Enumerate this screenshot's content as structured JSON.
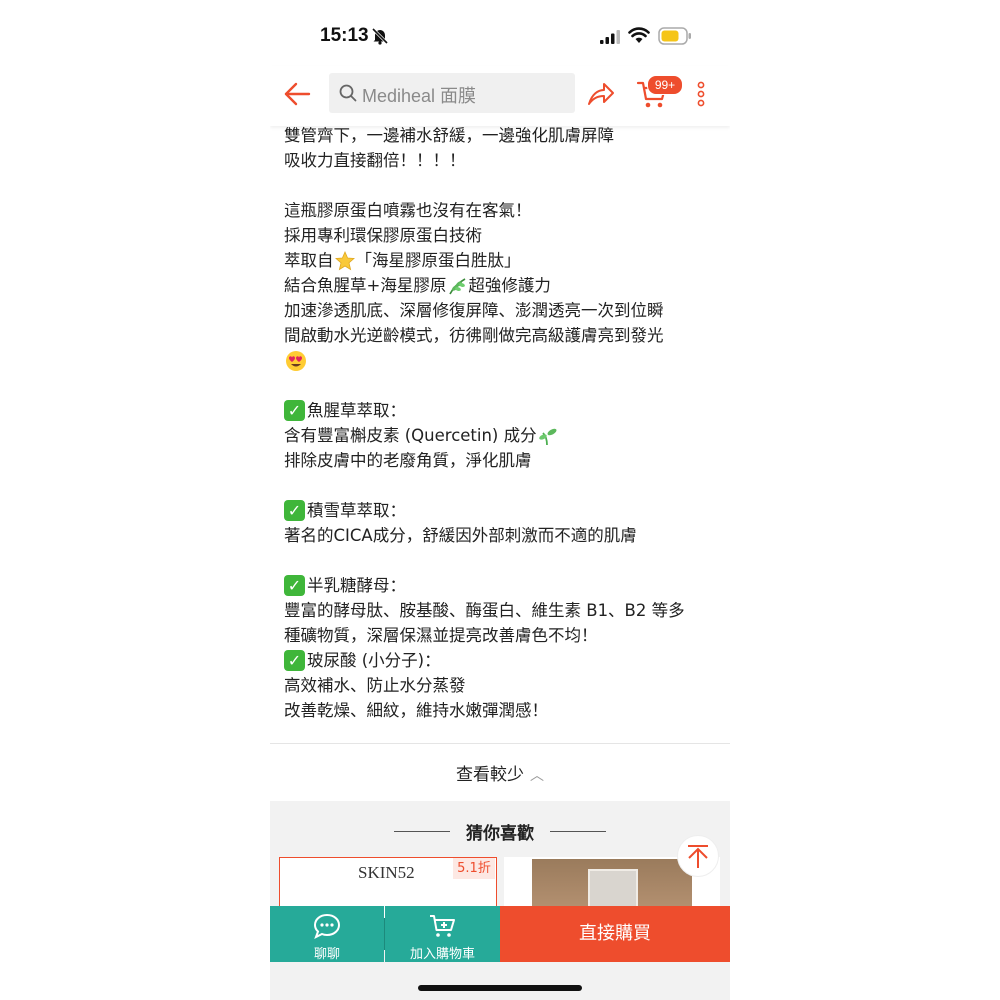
{
  "status_bar": {
    "time": "15:13"
  },
  "header": {
    "search_placeholder": "Mediheal 面膜",
    "cart_badge": "99+"
  },
  "description": {
    "lines": [
      "雙管齊下，一邊補水舒緩，一邊強化肌膚屏障",
      "吸收力直接翻倍！！！！",
      "",
      "這瓶膠原蛋白噴霧也沒有在客氣！",
      "採用專利環保膠原蛋白技術",
      "萃取自{star}「海星膠原蛋白胜肽」",
      "結合魚腥草+海星膠原{herb}超強修護力",
      "加速滲透肌底、深層修復屏障、澎潤透亮一次到位瞬",
      "間啟動水光逆齡模式，彷彿剛做完高級護膚亮到發光",
      "{hearteyes}",
      "",
      "{check}魚腥草萃取：",
      "含有豐富槲皮素 (Quercetin) 成分{seedling}",
      "排除皮膚中的老廢角質，淨化肌膚",
      "",
      "{check}積雪草萃取：",
      "著名的CICA成分，舒緩因外部刺激而不適的肌膚",
      "",
      "{check}半乳糖酵母：",
      "豐富的酵母肽、胺基酸、酶蛋白、維生素 B1、B2 等多",
      "種礦物質，深層保濕並提亮改善膚色不均！",
      "{check}玻尿酸 (小分子)：",
      "高效補水、防止水分蒸發",
      "改善乾燥、細紋，維持水嫩彈潤感！"
    ]
  },
  "see_less": {
    "label": "查看較少"
  },
  "recommend": {
    "title": "猜你喜歡",
    "products": [
      {
        "brand": "SKIN52",
        "discount": "5.1折"
      },
      {
        "brand": "",
        "discount": ""
      }
    ]
  },
  "bottom_bar": {
    "chat_label": "聊聊",
    "add_cart_label": "加入購物車",
    "buy_label": "直接購買"
  },
  "colors": {
    "accent": "#ee4d2d",
    "teal": "#26aa99",
    "check_green": "#3fb63a"
  },
  "icons": [
    "bell-slash-icon",
    "signal-icon",
    "wifi-icon",
    "battery-icon",
    "back-arrow-icon",
    "search-icon",
    "share-icon",
    "cart-icon",
    "more-vertical-icon",
    "back-to-top-icon",
    "chat-icon",
    "add-to-cart-icon",
    "star-emoji",
    "herb-emoji",
    "heart-eyes-emoji",
    "seedling-emoji",
    "check-mark-icon"
  ]
}
